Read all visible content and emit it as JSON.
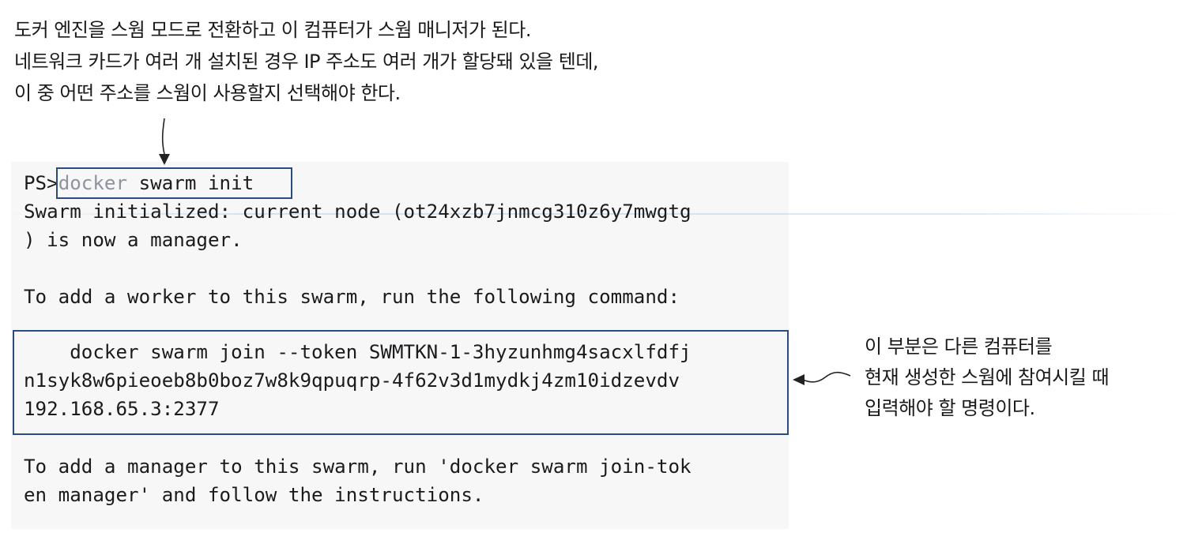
{
  "top_annotation": {
    "lines": [
      "도커 엔진을 스웜 모드로 전환하고 이 컴퓨터가 스웜 매니저가 된다.",
      "네트워크 카드가 여러 개 설치된 경우 IP 주소도 여러 개가 할당돼 있을 텐데,",
      "이 중 어떤 주소를 스웜이 사용할지 선택해야 한다."
    ]
  },
  "terminal": {
    "prompt": "PS>",
    "command_first": "docker",
    "command_rest": " swarm init",
    "lines": [
      "Swarm initialized: current node (ot24xzb7jnmcg310z6y7mwgtg",
      ") is now a manager.",
      "",
      "To add a worker to this swarm, run the following command:",
      "",
      "    docker swarm join --token SWMTKN-1-3hyzunhmg4sacxlfdfj",
      "n1syk8w6pieoeb8b0boz7w8k9qpuqrp-4f62v3d1mydkj4zm10idzevdv",
      "192.168.65.3:2377",
      "",
      "To add a manager to this swarm, run 'docker swarm join-tok",
      "en manager' and follow the instructions."
    ]
  },
  "side_annotation": {
    "lines": [
      "이 부분은 다른 컴퓨터를",
      "현재 생성한 스웜에 참여시킬 때",
      "입력해야 할 명령이다."
    ]
  },
  "colors": {
    "box_border": "#2c4b7f",
    "terminal_bg": "#f7f7f7",
    "command_gray": "#8e949e"
  }
}
